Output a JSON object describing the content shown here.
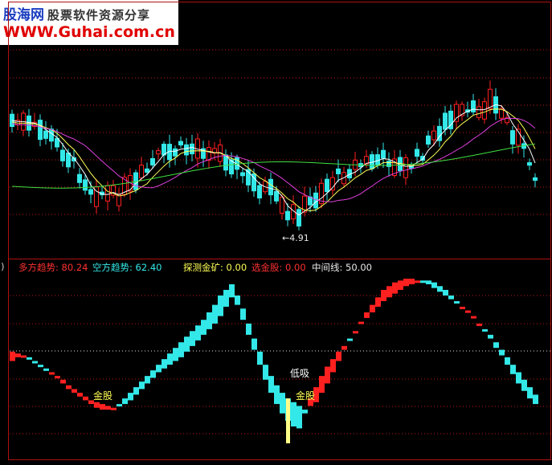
{
  "watermark": {
    "line1_a": "股海网",
    "line1_b": "股票软件资源分享",
    "line2": "WWW.Guhai.com.cn"
  },
  "indicator_legend": {
    "lead": ")",
    "long_trend": "多方趋势: 80.24",
    "short_trend": "空方趋势: 62.40",
    "probe": "探测金矿: 0.00",
    "select": "选金股: 0.00",
    "midline": "中间线: 50.00"
  },
  "colors": {
    "up": "#ff2020",
    "down": "#33e8e8",
    "ma1": "#ffffff",
    "ma2": "#ffff55",
    "ma3": "#e040e0",
    "ma4": "#40e040",
    "grid": "#c01818"
  },
  "chart_data": [
    {
      "type": "candlestick",
      "annotations": [
        {
          "text": "←4.91",
          "x": 49,
          "value": 4.91
        }
      ],
      "ohlc_x": "bar index 0-93",
      "ma_series": [
        "short MA (white)",
        "mid MA (yellow)",
        "long MA (magenta)",
        "longest MA (green)"
      ]
    },
    {
      "type": "area",
      "ylim": [
        0,
        100
      ],
      "midline": 50,
      "labels": [
        {
          "text": "金股",
          "x": 16
        },
        {
          "text": "低吸",
          "x": 51
        },
        {
          "text": "金股",
          "x": 52
        }
      ],
      "series": [
        {
          "name": "多方趋势",
          "values": [
            55,
            54,
            53,
            51,
            49,
            47,
            45,
            44,
            42,
            40,
            37,
            35,
            33,
            31,
            29,
            28,
            27,
            26,
            25,
            26,
            27,
            29,
            32,
            35,
            38,
            41,
            44,
            46,
            48,
            50,
            52,
            55,
            58,
            61,
            64,
            67,
            70,
            74,
            79,
            84,
            80,
            72,
            64,
            56,
            48,
            40,
            33,
            27,
            22,
            18,
            15,
            14,
            22,
            30,
            36,
            42,
            47,
            51,
            55,
            58,
            61,
            66,
            71,
            76,
            80,
            84,
            88,
            90,
            92,
            93,
            94,
            94,
            93,
            92,
            91,
            89,
            87,
            85,
            83,
            81,
            79,
            77,
            74,
            70,
            66,
            62,
            57,
            53,
            48,
            43,
            38,
            34,
            30,
            27
          ]
        },
        {
          "name": "空方趋势",
          "values": [
            50,
            52,
            53,
            52,
            50,
            48,
            46,
            43,
            41,
            38,
            35,
            33,
            31,
            29,
            27,
            25,
            24,
            24,
            25,
            27,
            30,
            33,
            36,
            39,
            42,
            45,
            48,
            51,
            54,
            57,
            60,
            63,
            66,
            69,
            72,
            76,
            80,
            85,
            88,
            91,
            85,
            78,
            70,
            62,
            55,
            48,
            42,
            37,
            33,
            30,
            28,
            26,
            24,
            26,
            28,
            33,
            38,
            44,
            50,
            56,
            62,
            66,
            70,
            73,
            76,
            79,
            82,
            84,
            86,
            88,
            90,
            91,
            92,
            93,
            93,
            92,
            90,
            88,
            85,
            82,
            79,
            76,
            73,
            70,
            67,
            64,
            60,
            56,
            52,
            48,
            44,
            40,
            36,
            32
          ]
        }
      ]
    }
  ]
}
